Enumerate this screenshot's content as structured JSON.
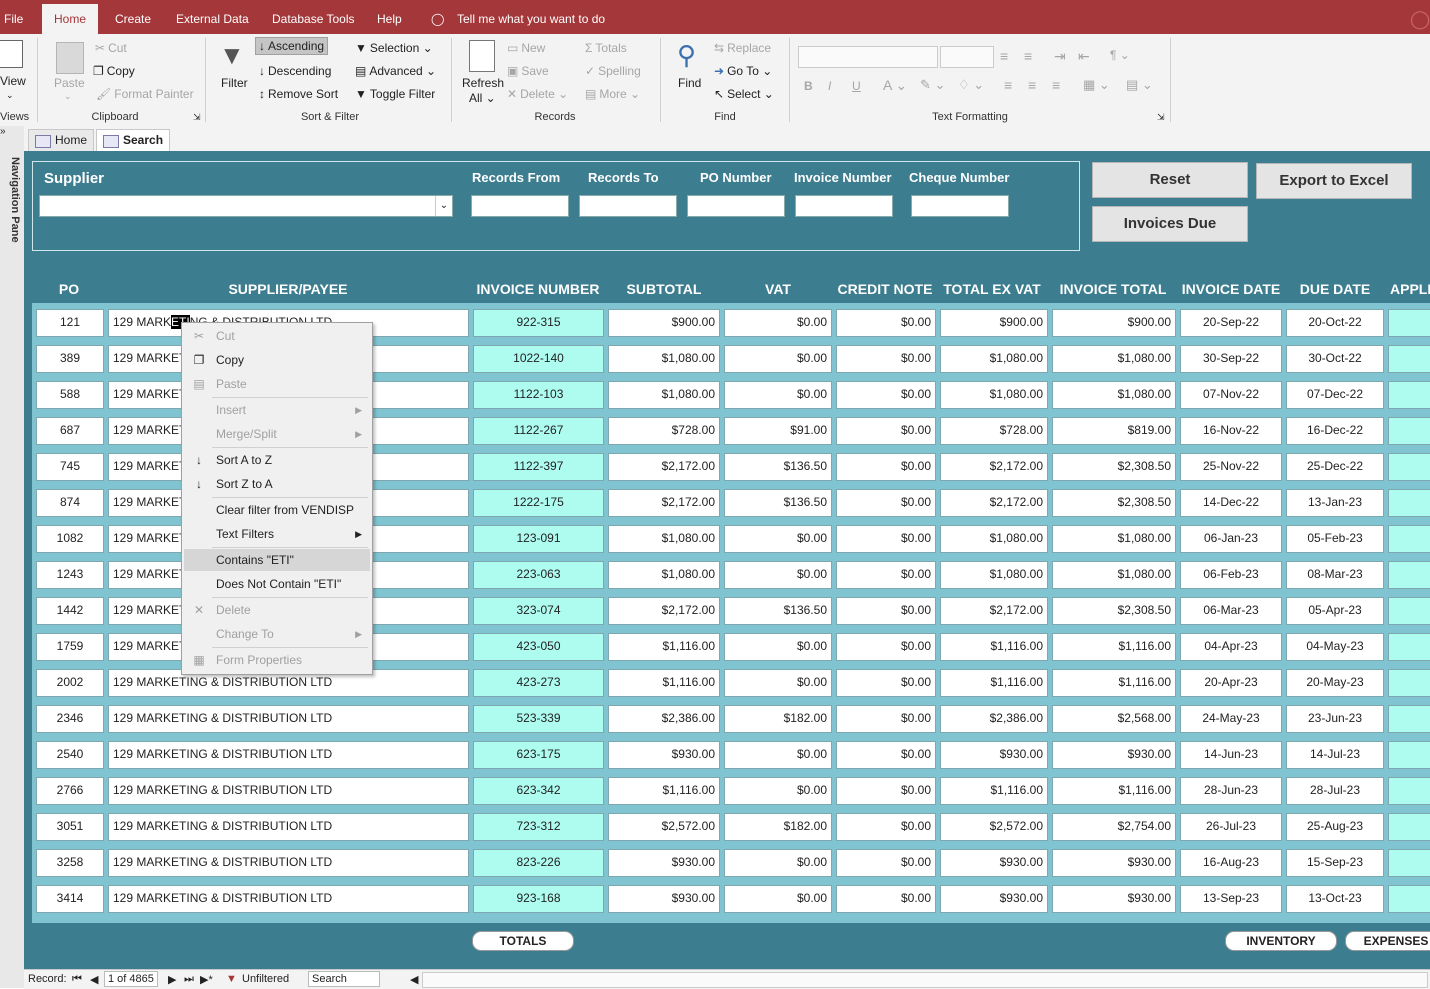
{
  "ribbon_tabs": [
    "File",
    "Home",
    "Create",
    "External Data",
    "Database Tools",
    "Help"
  ],
  "active_tab": "Home",
  "tell_me": "Tell me what you want to do",
  "views": {
    "label": "View",
    "group": "Views"
  },
  "clipboard": {
    "paste": "Paste",
    "cut": "Cut",
    "copy": "Copy",
    "format_painter": "Format Painter",
    "group": "Clipboard"
  },
  "sort_filter": {
    "filter": "Filter",
    "ascending": "Ascending",
    "descending": "Descending",
    "remove_sort": "Remove Sort",
    "selection": "Selection",
    "advanced": "Advanced",
    "toggle_filter": "Toggle Filter",
    "group": "Sort & Filter"
  },
  "records": {
    "refresh": "Refresh",
    "all": "All",
    "new": "New",
    "save": "Save",
    "delete": "Delete",
    "totals": "Totals",
    "spelling": "Spelling",
    "more": "More",
    "group": "Records"
  },
  "find": {
    "find": "Find",
    "replace": "Replace",
    "goto": "Go To",
    "select": "Select",
    "group": "Find"
  },
  "text_formatting": {
    "group": "Text Formatting",
    "bold": "B",
    "italic": "I",
    "underline": "U"
  },
  "doc_tabs": [
    "Home",
    "Search"
  ],
  "nav_pane": "Navigation Pane",
  "filters": {
    "supplier_label": "Supplier",
    "supplier_value": "",
    "records_from": "Records From",
    "records_to": "Records To",
    "po_number": "PO Number",
    "invoice_number": "Invoice Number",
    "cheque_number": "Cheque Number"
  },
  "buttons": {
    "reset": "Reset",
    "export": "Export to Excel",
    "invoices_due": "Invoices Due",
    "totals": "TOTALS",
    "inventory": "INVENTORY",
    "expenses": "EXPENSES"
  },
  "columns": [
    "PO",
    "SUPPLIER/PAYEE",
    "INVOICE NUMBER",
    "SUBTOTAL",
    "VAT",
    "CREDIT NOTE",
    "TOTAL EX VAT",
    "INVOICE TOTAL",
    "INVOICE DATE",
    "DUE DATE",
    "APPLI"
  ],
  "selected_text": "ETI",
  "rows": [
    {
      "po": "121",
      "supplier": "129 MARKETING & DISTRIBUTION LTD",
      "inv": "922-315",
      "sub": "$900.00",
      "vat": "$0.00",
      "cn": "$0.00",
      "exvat": "$900.00",
      "total": "$900.00",
      "date": "20-Sep-22",
      "due": "20-Oct-22"
    },
    {
      "po": "389",
      "supplier": "129 MARKETING & DISTRIBUTION LTD",
      "inv": "1022-140",
      "sub": "$1,080.00",
      "vat": "$0.00",
      "cn": "$0.00",
      "exvat": "$1,080.00",
      "total": "$1,080.00",
      "date": "30-Sep-22",
      "due": "30-Oct-22"
    },
    {
      "po": "588",
      "supplier": "129 MARKETING & DISTRIBUTION LTD",
      "inv": "1122-103",
      "sub": "$1,080.00",
      "vat": "$0.00",
      "cn": "$0.00",
      "exvat": "$1,080.00",
      "total": "$1,080.00",
      "date": "07-Nov-22",
      "due": "07-Dec-22"
    },
    {
      "po": "687",
      "supplier": "129 MARKETING & DISTRIBUTION LTD",
      "inv": "1122-267",
      "sub": "$728.00",
      "vat": "$91.00",
      "cn": "$0.00",
      "exvat": "$728.00",
      "total": "$819.00",
      "date": "16-Nov-22",
      "due": "16-Dec-22"
    },
    {
      "po": "745",
      "supplier": "129 MARKETING & DISTRIBUTION LTD",
      "inv": "1122-397",
      "sub": "$2,172.00",
      "vat": "$136.50",
      "cn": "$0.00",
      "exvat": "$2,172.00",
      "total": "$2,308.50",
      "date": "25-Nov-22",
      "due": "25-Dec-22"
    },
    {
      "po": "874",
      "supplier": "129 MARKETING & DISTRIBUTION LTD",
      "inv": "1222-175",
      "sub": "$2,172.00",
      "vat": "$136.50",
      "cn": "$0.00",
      "exvat": "$2,172.00",
      "total": "$2,308.50",
      "date": "14-Dec-22",
      "due": "13-Jan-23"
    },
    {
      "po": "1082",
      "supplier": "129 MARKETING & DISTRIBUTION LTD",
      "inv": "123-091",
      "sub": "$1,080.00",
      "vat": "$0.00",
      "cn": "$0.00",
      "exvat": "$1,080.00",
      "total": "$1,080.00",
      "date": "06-Jan-23",
      "due": "05-Feb-23"
    },
    {
      "po": "1243",
      "supplier": "129 MARKETING & DISTRIBUTION LTD",
      "inv": "223-063",
      "sub": "$1,080.00",
      "vat": "$0.00",
      "cn": "$0.00",
      "exvat": "$1,080.00",
      "total": "$1,080.00",
      "date": "06-Feb-23",
      "due": "08-Mar-23"
    },
    {
      "po": "1442",
      "supplier": "129 MARKETING & DISTRIBUTION LTD",
      "inv": "323-074",
      "sub": "$2,172.00",
      "vat": "$136.50",
      "cn": "$0.00",
      "exvat": "$2,172.00",
      "total": "$2,308.50",
      "date": "06-Mar-23",
      "due": "05-Apr-23"
    },
    {
      "po": "1759",
      "supplier": "129 MARKETING & DISTRIBUTION LTD",
      "inv": "423-050",
      "sub": "$1,116.00",
      "vat": "$0.00",
      "cn": "$0.00",
      "exvat": "$1,116.00",
      "total": "$1,116.00",
      "date": "04-Apr-23",
      "due": "04-May-23"
    },
    {
      "po": "2002",
      "supplier": "129 MARKETING & DISTRIBUTION LTD",
      "inv": "423-273",
      "sub": "$1,116.00",
      "vat": "$0.00",
      "cn": "$0.00",
      "exvat": "$1,116.00",
      "total": "$1,116.00",
      "date": "20-Apr-23",
      "due": "20-May-23"
    },
    {
      "po": "2346",
      "supplier": "129 MARKETING & DISTRIBUTION LTD",
      "inv": "523-339",
      "sub": "$2,386.00",
      "vat": "$182.00",
      "cn": "$0.00",
      "exvat": "$2,386.00",
      "total": "$2,568.00",
      "date": "24-May-23",
      "due": "23-Jun-23"
    },
    {
      "po": "2540",
      "supplier": "129 MARKETING & DISTRIBUTION LTD",
      "inv": "623-175",
      "sub": "$930.00",
      "vat": "$0.00",
      "cn": "$0.00",
      "exvat": "$930.00",
      "total": "$930.00",
      "date": "14-Jun-23",
      "due": "14-Jul-23"
    },
    {
      "po": "2766",
      "supplier": "129 MARKETING & DISTRIBUTION LTD",
      "inv": "623-342",
      "sub": "$1,116.00",
      "vat": "$0.00",
      "cn": "$0.00",
      "exvat": "$1,116.00",
      "total": "$1,116.00",
      "date": "28-Jun-23",
      "due": "28-Jul-23"
    },
    {
      "po": "3051",
      "supplier": "129 MARKETING & DISTRIBUTION LTD",
      "inv": "723-312",
      "sub": "$2,572.00",
      "vat": "$182.00",
      "cn": "$0.00",
      "exvat": "$2,572.00",
      "total": "$2,754.00",
      "date": "26-Jul-23",
      "due": "25-Aug-23"
    },
    {
      "po": "3258",
      "supplier": "129 MARKETING & DISTRIBUTION LTD",
      "inv": "823-226",
      "sub": "$930.00",
      "vat": "$0.00",
      "cn": "$0.00",
      "exvat": "$930.00",
      "total": "$930.00",
      "date": "16-Aug-23",
      "due": "15-Sep-23"
    },
    {
      "po": "3414",
      "supplier": "129 MARKETING & DISTRIBUTION LTD",
      "inv": "923-168",
      "sub": "$930.00",
      "vat": "$0.00",
      "cn": "$0.00",
      "exvat": "$930.00",
      "total": "$930.00",
      "date": "13-Sep-23",
      "due": "13-Oct-23"
    }
  ],
  "context_menu": [
    {
      "label": "Cut",
      "disabled": true,
      "icon": "scissors-icon"
    },
    {
      "label": "Copy",
      "disabled": false,
      "icon": "copy-icon"
    },
    {
      "label": "Paste",
      "disabled": true,
      "icon": "paste-icon"
    },
    {
      "label": "Insert",
      "disabled": true,
      "submenu": true
    },
    {
      "label": "Merge/Split",
      "disabled": true,
      "submenu": true
    },
    {
      "label": "Sort A to Z",
      "disabled": false,
      "icon": "sort-ascending-icon"
    },
    {
      "label": "Sort Z to A",
      "disabled": false,
      "icon": "sort-descending-icon"
    },
    {
      "label": "Clear filter from VENDISP",
      "disabled": false
    },
    {
      "label": "Text Filters",
      "disabled": false,
      "submenu": true
    },
    {
      "label": "Contains \"ETI\"",
      "disabled": false,
      "highlighted": true
    },
    {
      "label": "Does Not Contain \"ETI\"",
      "disabled": false
    },
    {
      "label": "Delete",
      "disabled": true,
      "icon": "delete-icon"
    },
    {
      "label": "Change To",
      "disabled": true,
      "submenu": true
    },
    {
      "label": "Form Properties",
      "disabled": true,
      "icon": "properties-icon"
    }
  ],
  "status": {
    "record_label": "Record:",
    "record_pos": "1 of 4865",
    "filter": "Unfiltered",
    "search": "Search"
  },
  "colors": {
    "ribbon": "#a4373a",
    "form_bg": "#3c7d8f",
    "invoice_cell": "#aefbf0"
  }
}
